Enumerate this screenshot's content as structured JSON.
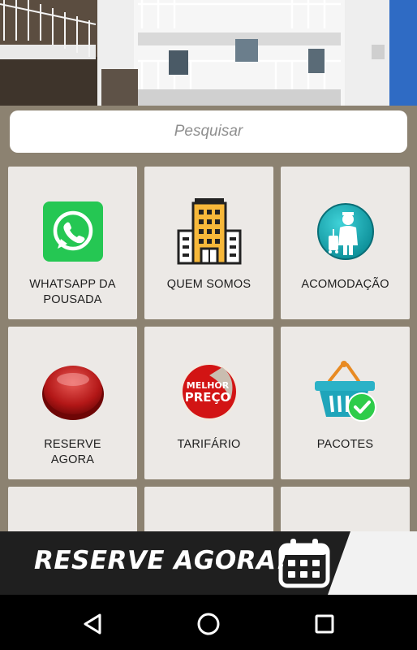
{
  "search": {
    "placeholder": "Pesquisar"
  },
  "tiles": [
    {
      "label": "WHATSAPP DA POUSADA",
      "icon": "whatsapp-icon"
    },
    {
      "label": "QUEM SOMOS",
      "icon": "building-icon"
    },
    {
      "label": "ACOMODAÇÃO",
      "icon": "bellboy-icon"
    },
    {
      "label": "RESERVE AGORA",
      "icon": "red-button-icon"
    },
    {
      "label": "TARIFÁRIO",
      "icon": "best-price-badge-icon",
      "badge_line1": "MELHOR",
      "badge_line2": "PREÇO"
    },
    {
      "label": "PACOTES",
      "icon": "basket-check-icon"
    }
  ],
  "banner": {
    "text": "RESERVE AGORA!",
    "icon": "calendar-icon"
  },
  "navbar": {
    "back_icon": "back-triangle-icon",
    "home_icon": "home-circle-icon",
    "recents_icon": "recents-square-icon"
  },
  "colors": {
    "whatsapp": "#25d366",
    "tile_bg": "#ece9e6",
    "content_bg": "#8c8271",
    "banner_bg": "#1f1f1f"
  }
}
